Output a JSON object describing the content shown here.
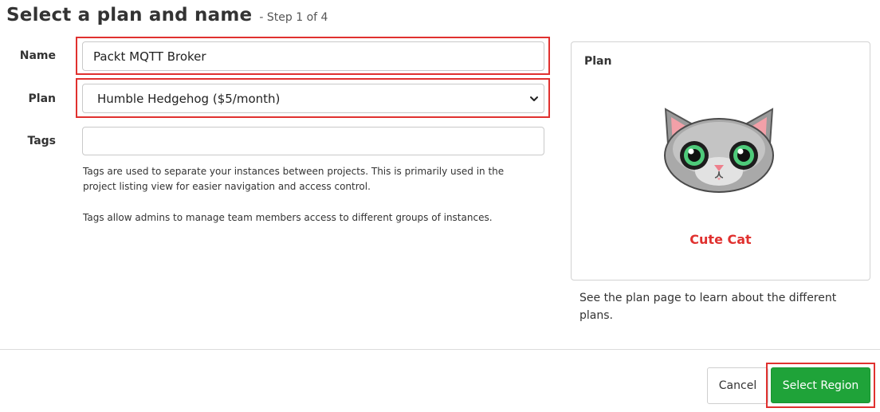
{
  "header": {
    "title": "Select a plan and name",
    "step": "- Step 1 of 4"
  },
  "form": {
    "name_label": "Name",
    "name_value": "Packt MQTT Broker",
    "plan_label": "Plan",
    "plan_selected": "Humble Hedgehog ($5/month)",
    "tags_label": "Tags",
    "tags_value": "",
    "tags_help_1": "Tags are used to separate your instances between projects. This is primarily used in the project listing view for easier navigation and access control.",
    "tags_help_2": "Tags allow admins to manage team members access to different groups of instances."
  },
  "plan_card": {
    "title": "Plan",
    "mascot_name": "Cute Cat",
    "mascot_icon": "cat-mascot-icon",
    "note": "See the plan page to learn about the different plans."
  },
  "footer": {
    "cancel_label": "Cancel",
    "primary_label": "Select Region"
  },
  "colors": {
    "highlight": "#e0312f",
    "primary": "#1fa339",
    "mascot_text": "#e0312f"
  }
}
